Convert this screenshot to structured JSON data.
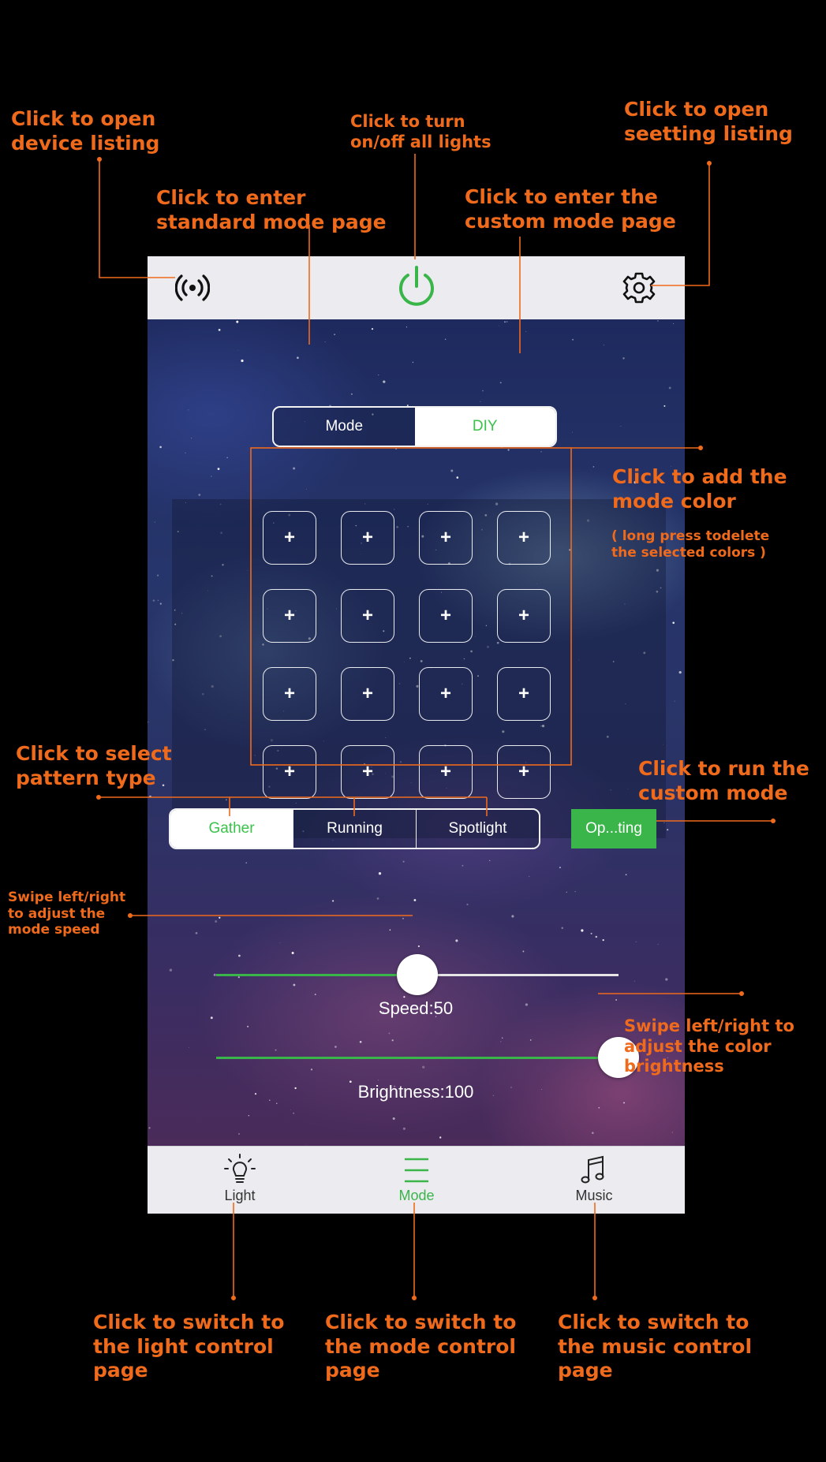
{
  "app": {
    "mode_tabs": [
      {
        "label": "Mode",
        "active": false
      },
      {
        "label": "DIY",
        "active": true
      }
    ],
    "color_grid": {
      "rows": [
        [
          "+",
          "+",
          "+",
          "+"
        ],
        [
          "+",
          "+",
          "+",
          "+"
        ],
        [
          "+",
          "+",
          "+",
          "+"
        ],
        [
          "+",
          "+",
          "+",
          "+"
        ]
      ]
    },
    "pattern_tabs": [
      {
        "label": "Gather",
        "active": true
      },
      {
        "label": "Running",
        "active": false
      },
      {
        "label": "Spotlight",
        "active": false
      }
    ],
    "run_button_label": "Op...ting",
    "speed": {
      "label": "Speed:50",
      "value": 50,
      "max": 100
    },
    "brightness": {
      "label": "Brightness:100",
      "value": 100,
      "max": 100
    },
    "tabbar": [
      {
        "label": "Light",
        "icon": "bulb-icon",
        "active": false
      },
      {
        "label": "Mode",
        "icon": "menu-lines-icon",
        "active": true
      },
      {
        "label": "Music",
        "icon": "music-note-icon",
        "active": false
      }
    ],
    "icons": {
      "left": "broadcast-icon",
      "center": "power-icon",
      "right": "gear-icon"
    },
    "colors": {
      "accent_green": "#3ab54a",
      "annotation_orange": "#f06a1c"
    }
  },
  "annotations": {
    "device_listing": "Click to open\ndevice listing",
    "power": "Click to turn\non/off all lights",
    "settings": "Click to open\nseetting listing",
    "standard_mode": "Click to enter\nstandard mode page",
    "custom_mode": "Click to enter the\ncustom mode page",
    "add_color": "Click to add the\nmode color",
    "add_color_note": "( long press todelete\nthe selected colors )",
    "pattern_type": "Click to select\npattern type",
    "run_custom": "Click to run the\ncustom mode",
    "speed": "Swipe left/right\nto adjust the\nmode speed",
    "brightness": "Swipe left/right to\nadjust the color\nbrightness",
    "light_page": "Click to switch to\nthe light control\npage",
    "mode_page": "Click to switch to\nthe mode control\npage",
    "music_page": "Click to switch to\nthe music control\npage"
  }
}
